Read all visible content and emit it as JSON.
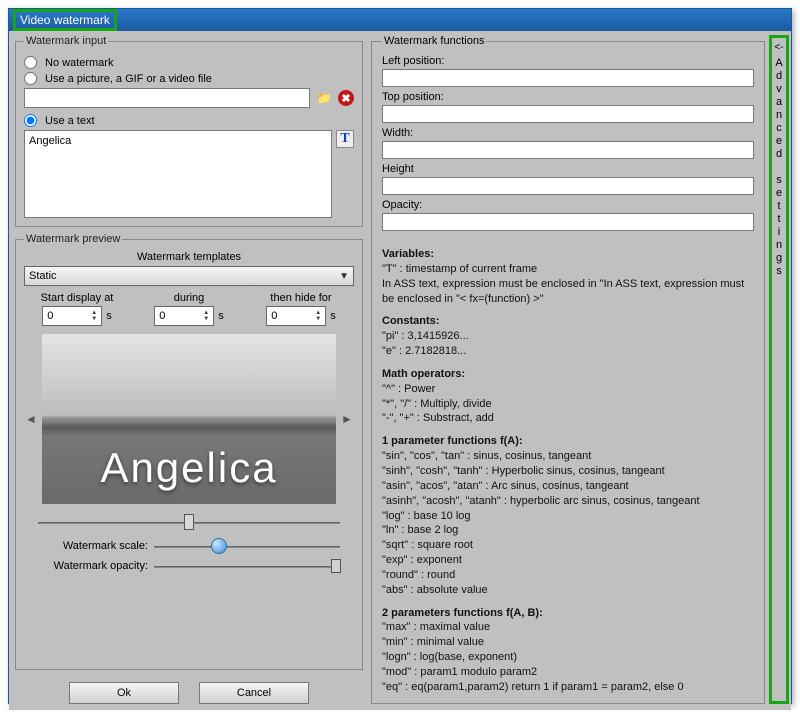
{
  "window": {
    "title": "Video watermark"
  },
  "input_group": {
    "legend": "Watermark input",
    "opt_none": "No watermark",
    "opt_file": "Use a picture, a GIF or a video file",
    "opt_text": "Use a text",
    "file_value": "",
    "text_value": "Angelica"
  },
  "preview_group": {
    "legend": "Watermark preview",
    "templates_label": "Watermark templates",
    "template_value": "Static",
    "timing": {
      "start_label": "Start display at",
      "during_label": "during",
      "hide_label": "then hide for",
      "start_value": "0",
      "during_value": "0",
      "hide_value": "0",
      "unit": "s"
    },
    "preview_text": "Angelica",
    "scale_label": "Watermark scale:",
    "opacity_label": "Watermark opacity:"
  },
  "buttons": {
    "ok": "Ok",
    "cancel": "Cancel"
  },
  "func_group": {
    "legend": "Watermark functions",
    "left_label": "Left position:",
    "top_label": "Top position:",
    "width_label": "Width:",
    "height_label": "Height",
    "opacity_label": "Opacity:",
    "doc": {
      "variables_h": "Variables:",
      "variables_l1": "\"T\"    : timestamp of current frame",
      "variables_l2": "In ASS text, expression must be enclosed in \"In ASS text, expression must be enclosed in \"< fx=(function) >\"",
      "constants_h": "Constants:",
      "constants_l1": "\"pi\"   : 3,1415926...",
      "constants_l2": "\"e\"    : 2.7182818...",
      "math_h": "Math operators:",
      "math_l1": "\"^\"     : Power",
      "math_l2": "\"*\", \"/\" : Multiply, divide",
      "math_l3": "\"-\", \"+\" : Substract, add",
      "p1_h": "1 parameter functions f(A):",
      "p1_l1": "\"sin\", \"cos\", \"tan\"    : sinus, cosinus, tangeant",
      "p1_l2": "\"sinh\", \"cosh\", \"tanh\" : Hyperbolic sinus, cosinus, tangeant",
      "p1_l3": "\"asin\", \"acos\", \"atan\"  : Arc sinus, cosinus, tangeant",
      "p1_l4": "\"asinh\", \"acosh\", \"atanh\" : hyperbolic arc sinus, cosinus, tangeant",
      "p1_l5": "\"log\"    : base 10 log",
      "p1_l6": "\"ln\"     : base 2 log",
      "p1_l7": "\"sqrt\"   : square root",
      "p1_l8": "\"exp\"    : exponent",
      "p1_l9": "\"round\" : round",
      "p1_l10": "\"abs\"    : absolute value",
      "p2_h": "2 parameters functions f(A, B):",
      "p2_l1": "\"max\"   : maximal value",
      "p2_l2": "\"min\"    : minimal value",
      "p2_l3": "\"logn\"   : log(base, exponent)",
      "p2_l4": "\"mod\"   : param1 modulo param2",
      "p2_l5": "\"eq\"     : eq(param1,param2) return 1 if param1 = param2, else 0"
    }
  },
  "advanced": {
    "arrow": "<-",
    "text": "Advanced settings"
  }
}
